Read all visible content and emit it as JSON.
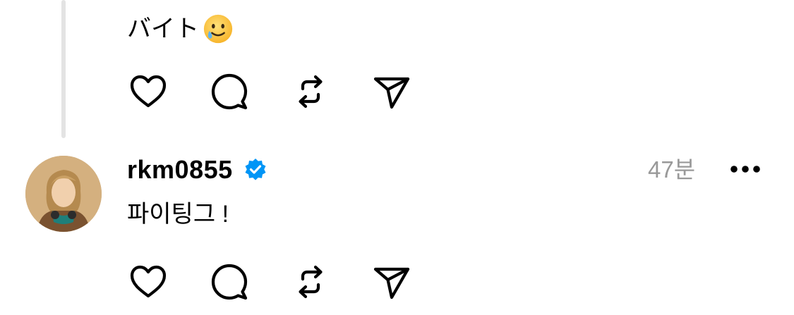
{
  "previous_post": {
    "text": "バイト",
    "emoji": "smiling-face-with-tear-icon"
  },
  "reply": {
    "username": "rkm0855",
    "verified": "verified-badge-icon",
    "timestamp": "47분",
    "text": "파이팅그 !"
  },
  "actions": [
    {
      "name": "like",
      "icon": "heart-icon"
    },
    {
      "name": "reply",
      "icon": "comment-icon"
    },
    {
      "name": "repost",
      "icon": "repost-icon"
    },
    {
      "name": "share",
      "icon": "send-icon"
    }
  ],
  "colors": {
    "verified_blue": "#0095f6",
    "timestamp_gray": "#999999",
    "thread_line": "#e3e3e3"
  }
}
